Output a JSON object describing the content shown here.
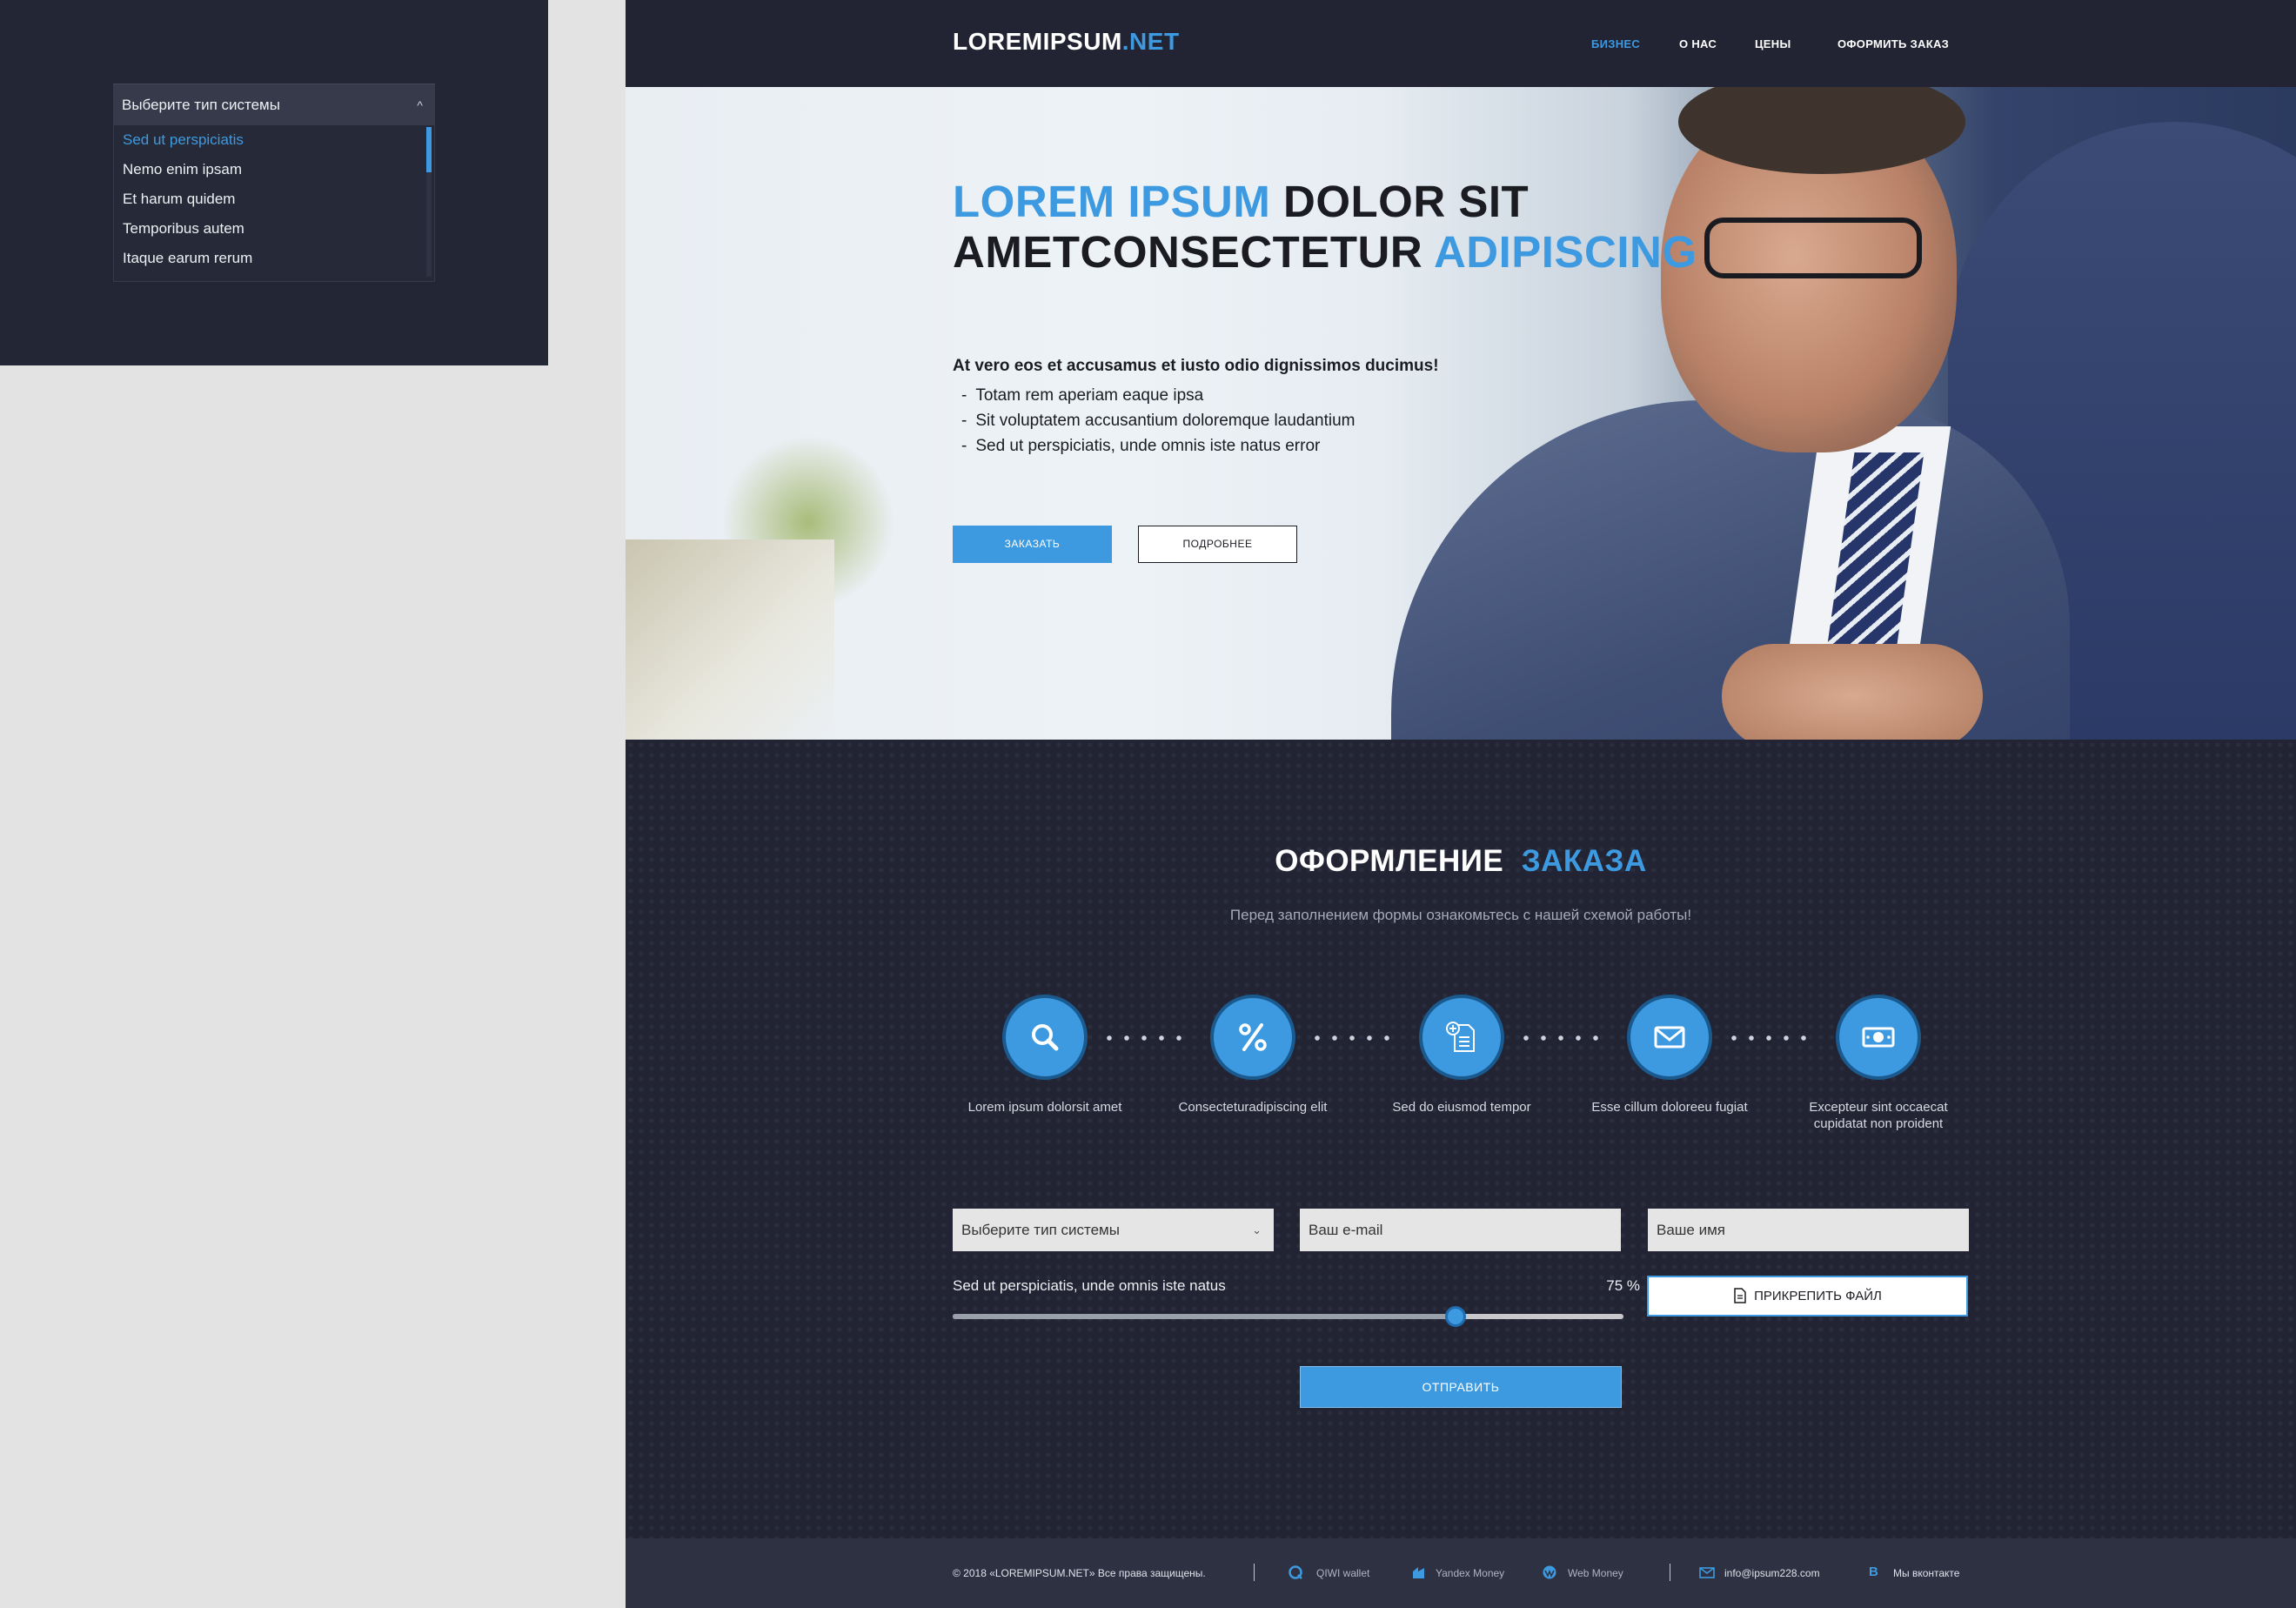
{
  "demo": {
    "select_placeholder": "Выберите тип системы",
    "options": [
      "Sed ut perspiciatis",
      "Nemo enim ipsam",
      "Et harum quidem",
      "Temporibus autem",
      "Itaque earum rerum"
    ],
    "selected_index": 0
  },
  "header": {
    "logo_main": "LOREMIPSUM",
    "logo_accent": ".NET",
    "nav": [
      "БИЗНЕС",
      "О НАС",
      "ЦЕНЫ",
      "ОФОРМИТЬ ЗАКАЗ"
    ],
    "active_nav_index": 0
  },
  "hero": {
    "title_line1_accent": "LOREM IPSUM",
    "title_line1_rest": " DOLOR SIT",
    "title_line2_rest": "AMETCONSECTETUR ",
    "title_line2_accent": "ADIPISCING",
    "lead": "At vero eos et accusamus et iusto odio dignissimos ducimus!",
    "bullets": [
      "Totam rem aperiam eaque ipsa",
      "Sit voluptatem accusantium doloremque laudantium",
      "Sed ut perspiciatis, unde omnis iste natus error"
    ],
    "order_button": "ЗАКАЗАТЬ",
    "more_button": "ПОДРОБНЕЕ"
  },
  "order": {
    "title": "ОФОРМЛЕНИЕ",
    "title_accent": "ЗАКАЗА",
    "subtitle": "Перед заполнением формы ознакомьтесь с нашей схемой работы!",
    "steps": [
      {
        "icon": "search-icon",
        "label": "Lorem ipsum dolorsit amet"
      },
      {
        "icon": "percent-icon",
        "label": "Consecteturadipiscing elit"
      },
      {
        "icon": "document-add-icon",
        "label": "Sed do eiusmod tempor"
      },
      {
        "icon": "envelope-icon",
        "label": "Esse cillum doloreeu fugiat"
      },
      {
        "icon": "money-icon",
        "label": "Excepteur sint occaecat cupidatat non proident"
      }
    ],
    "system_select": "Выберите тип системы",
    "email_placeholder": "Ваш e-mail",
    "name_placeholder": "Ваше имя",
    "slider_label": "Sed ut perspiciatis, unde omnis iste natus",
    "slider_value_text": "75 %",
    "slider_value": 0.75,
    "attach_button": "ПРИКРЕПИТЬ ФАЙЛ",
    "submit_button": "ОТПРАВИТЬ"
  },
  "footer": {
    "copyright": "© 2018 «LOREMIPSUM.NET» Все права защищены.",
    "qiwi": "QIWI wallet",
    "yandex": "Yandex Money",
    "webmoney": "Web Money",
    "email": "info@ipsum228.com",
    "vk": "Мы вконтакте"
  },
  "colors": {
    "accent": "#3d9ae0",
    "dark_bg": "#222433",
    "footer_bg": "#2e3142"
  }
}
